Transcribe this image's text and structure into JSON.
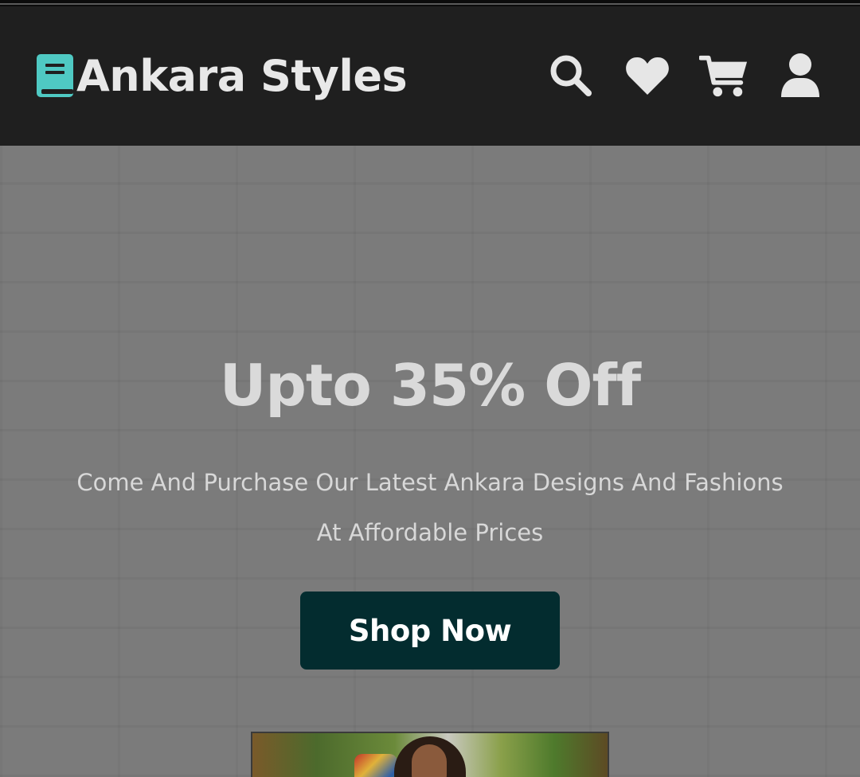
{
  "header": {
    "brand": "Ankara Styles",
    "logo_icon": "book-icon",
    "icons": [
      {
        "name": "search-icon",
        "label": "Search"
      },
      {
        "name": "heart-icon",
        "label": "Wishlist"
      },
      {
        "name": "cart-icon",
        "label": "Cart"
      },
      {
        "name": "user-icon",
        "label": "Account"
      }
    ]
  },
  "hero": {
    "headline": "Upto 35% Off",
    "subtext_line1": "Come And Purchase Our Latest Ankara Designs And Fashions",
    "subtext_line2": "At Affordable Prices",
    "cta_label": "Shop Now"
  },
  "colors": {
    "header_bg": "#1f1f1f",
    "logo_accent": "#4fc9c3",
    "hero_bg": "#7b7b7b",
    "cta_bg": "#032c2f",
    "cta_text": "#ffffff"
  }
}
